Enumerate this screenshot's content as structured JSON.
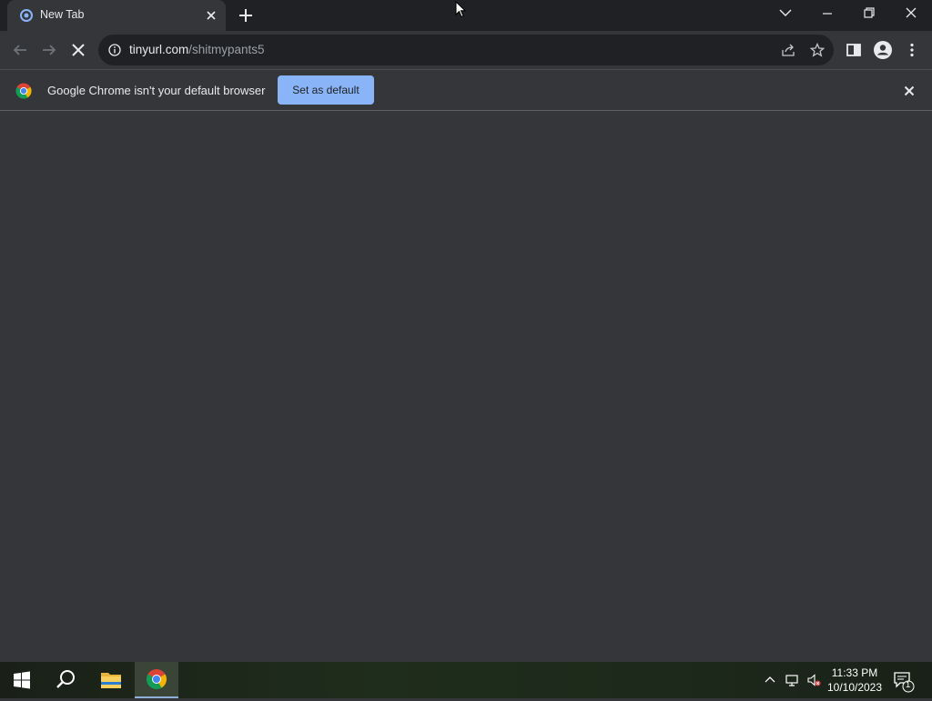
{
  "tab": {
    "title": "New Tab"
  },
  "omnibox": {
    "url_host": "tinyurl.com",
    "url_path": "/shitmypants5"
  },
  "infobar": {
    "message": "Google Chrome isn't your default browser",
    "button_label": "Set as default"
  },
  "taskbar": {
    "time": "11:33 PM",
    "date": "10/10/2023",
    "notification_count": "1"
  },
  "colors": {
    "accent": "#8ab4f8",
    "background": "#35363a",
    "tabstrip": "#202124"
  }
}
